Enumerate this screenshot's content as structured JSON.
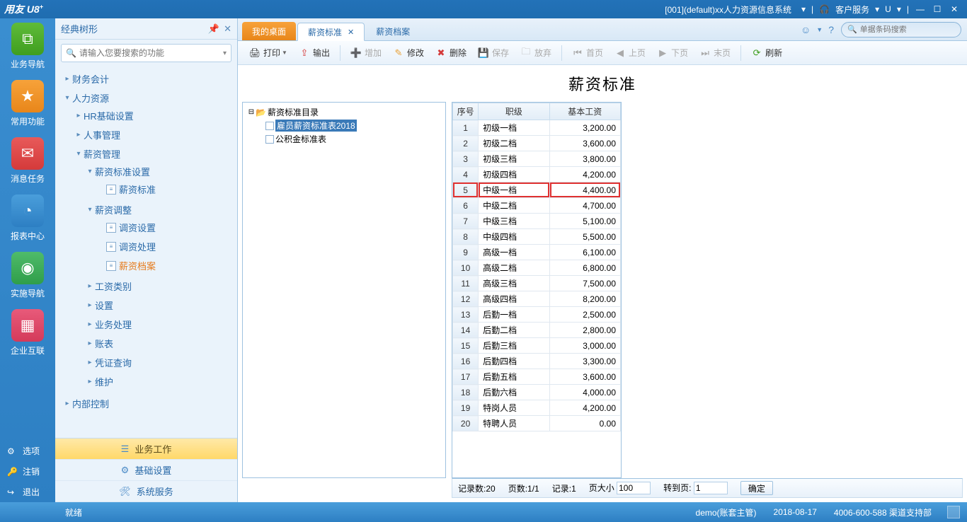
{
  "titlebar": {
    "logo": "用友 U8",
    "logo_sup": "+",
    "system_title": "[001](default)xx人力资源信息系统",
    "dropdown_icon": "▾",
    "customer_service": "客户服务",
    "u_label": "U"
  },
  "leftbar": {
    "items": [
      {
        "label": "业务导航",
        "icon": "folder-tree",
        "cls": "ic-green"
      },
      {
        "label": "常用功能",
        "icon": "star",
        "cls": "ic-orange"
      },
      {
        "label": "消息任务",
        "icon": "mail",
        "cls": "ic-red"
      },
      {
        "label": "报表中心",
        "icon": "pie",
        "cls": "ic-blue"
      },
      {
        "label": "实施导航",
        "icon": "compass",
        "cls": "ic-green2"
      },
      {
        "label": "企业互联",
        "icon": "squares",
        "cls": "ic-pink"
      }
    ],
    "bottom": [
      {
        "label": "选项",
        "icon": "⚙"
      },
      {
        "label": "注销",
        "icon": "🔑"
      },
      {
        "label": "退出",
        "icon": "↪"
      }
    ]
  },
  "treepanel": {
    "title": "经典树形",
    "search_placeholder": "请输入您要搜索的功能",
    "bottom": [
      {
        "label": "业务工作",
        "active": true
      },
      {
        "label": "基础设置",
        "active": false
      },
      {
        "label": "系统服务",
        "active": false
      }
    ],
    "nodes": {
      "fin": "财务会计",
      "hr": "人力资源",
      "hr_base": "HR基础设置",
      "hr_person": "人事管理",
      "salary_mgmt": "薪资管理",
      "salary_std_set": "薪资标准设置",
      "salary_std": "薪资标准",
      "salary_adj": "薪资调整",
      "adj_set": "调资设置",
      "adj_proc": "调资处理",
      "salary_file": "薪资档案",
      "salary_cat": "工资类别",
      "settings": "设置",
      "biz_proc": "业务处理",
      "ledger": "账表",
      "voucher_q": "凭证查询",
      "maint": "维护",
      "internal": "内部控制"
    }
  },
  "tabs": {
    "my_desktop": "我的桌面",
    "salary_standard": "薪资标准",
    "salary_file": "薪资档案",
    "search_placeholder": "单据条码搜索"
  },
  "toolbar": {
    "print": "打印",
    "export": "输出",
    "add": "增加",
    "modify": "修改",
    "delete": "删除",
    "save": "保存",
    "abandon": "放弃",
    "first": "首页",
    "prev": "上页",
    "next": "下页",
    "last": "末页",
    "refresh": "刷新"
  },
  "page_title": "薪资标准",
  "dir_tree": {
    "root": "薪资标准目录",
    "item1": "雇员薪资标准表2018",
    "item2": "公积金标准表"
  },
  "table": {
    "col_seq": "序号",
    "col_level": "职级",
    "col_base": "基本工资",
    "highlight_row": 5,
    "rows": [
      {
        "seq": 1,
        "level": "初级一档",
        "base": "3,200.00"
      },
      {
        "seq": 2,
        "level": "初级二档",
        "base": "3,600.00"
      },
      {
        "seq": 3,
        "level": "初级三档",
        "base": "3,800.00"
      },
      {
        "seq": 4,
        "level": "初级四档",
        "base": "4,200.00"
      },
      {
        "seq": 5,
        "level": "中级一档",
        "base": "4,400.00"
      },
      {
        "seq": 6,
        "level": "中级二档",
        "base": "4,700.00"
      },
      {
        "seq": 7,
        "level": "中级三档",
        "base": "5,100.00"
      },
      {
        "seq": 8,
        "level": "中级四档",
        "base": "5,500.00"
      },
      {
        "seq": 9,
        "level": "高级一档",
        "base": "6,100.00"
      },
      {
        "seq": 10,
        "level": "高级二档",
        "base": "6,800.00"
      },
      {
        "seq": 11,
        "level": "高级三档",
        "base": "7,500.00"
      },
      {
        "seq": 12,
        "level": "高级四档",
        "base": "8,200.00"
      },
      {
        "seq": 13,
        "level": "后勤一档",
        "base": "2,500.00"
      },
      {
        "seq": 14,
        "level": "后勤二档",
        "base": "2,800.00"
      },
      {
        "seq": 15,
        "level": "后勤三档",
        "base": "3,000.00"
      },
      {
        "seq": 16,
        "level": "后勤四档",
        "base": "3,300.00"
      },
      {
        "seq": 17,
        "level": "后勤五档",
        "base": "3,600.00"
      },
      {
        "seq": 18,
        "level": "后勤六档",
        "base": "4,000.00"
      },
      {
        "seq": 19,
        "level": "特岗人员",
        "base": "4,200.00"
      },
      {
        "seq": 20,
        "level": "特聘人员",
        "base": "0.00"
      }
    ]
  },
  "pager": {
    "record_count_label": "记录数:",
    "record_count": "20",
    "page_count_label": "页数:",
    "page_count": "1/1",
    "record_label": "记录:",
    "record": "1",
    "page_size_label": "页大小",
    "page_size": "100",
    "goto_label": "转到页:",
    "goto": "1",
    "confirm": "确定"
  },
  "statusbar": {
    "ready": "就绪",
    "user": "demo(账套主管)",
    "date": "2018-08-17",
    "support": "4006-600-588 渠道支持部"
  }
}
